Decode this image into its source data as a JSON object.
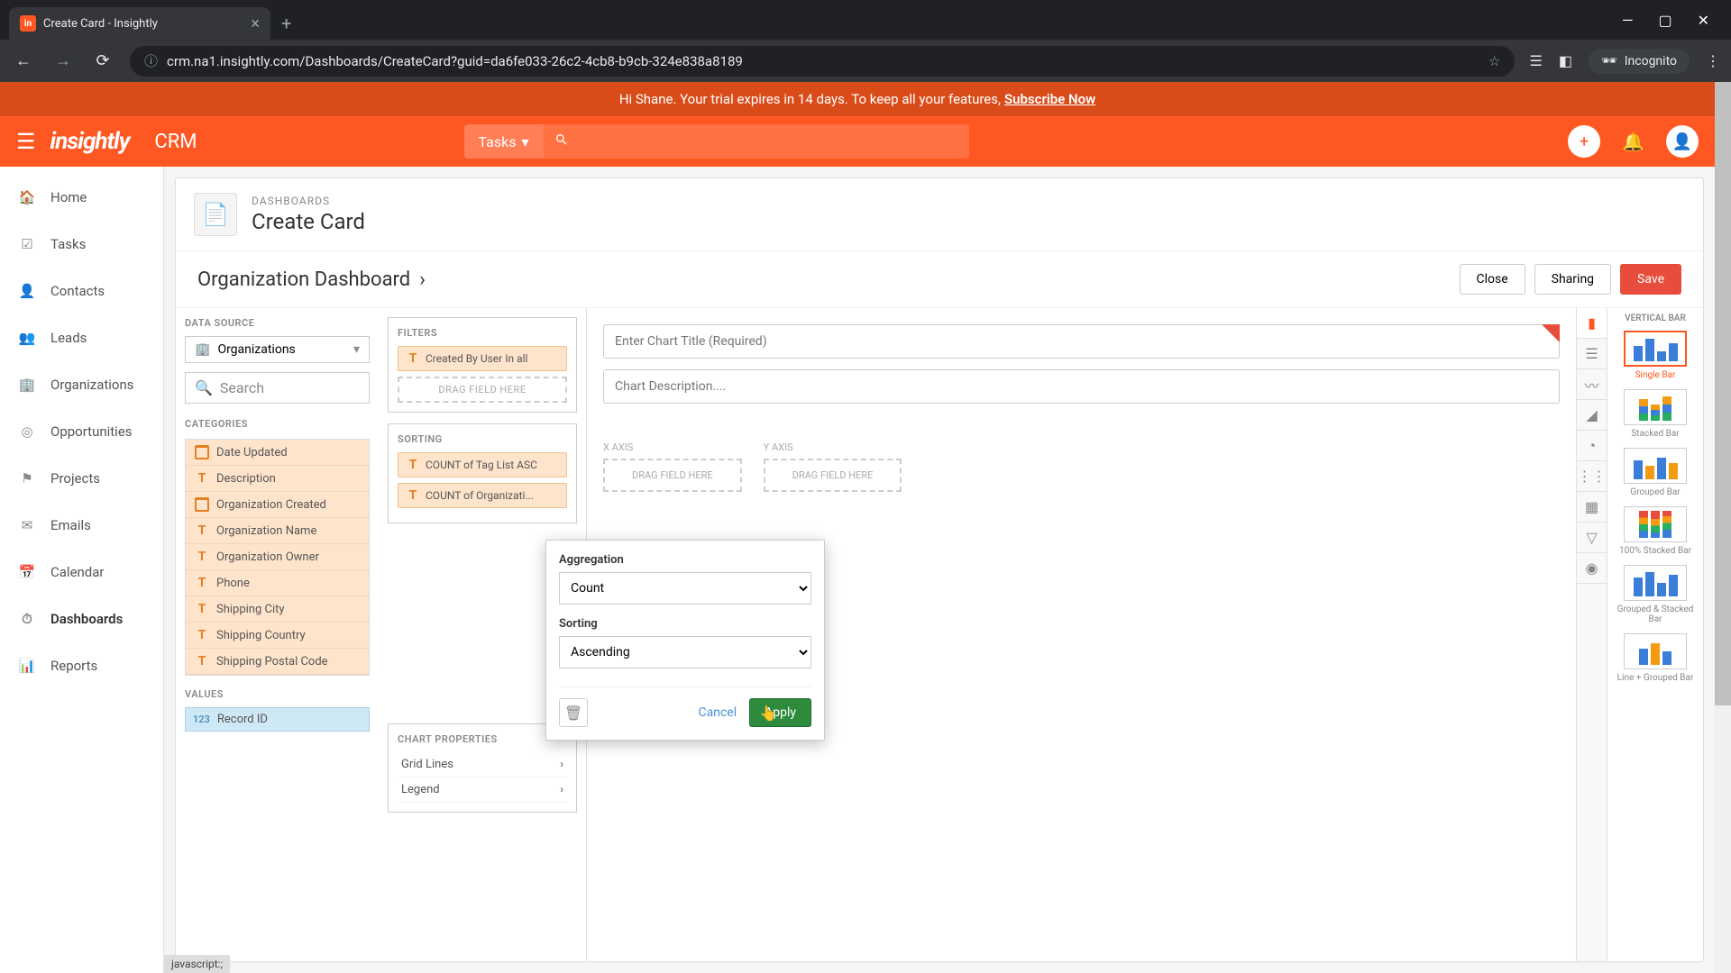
{
  "browser": {
    "tab_title": "Create Card - Insightly",
    "url": "crm.na1.insightly.com/Dashboards/CreateCard?guid=da6fe033-26c2-4cb8-b9cb-324e838a8189",
    "incognito": "Incognito"
  },
  "trial": {
    "greeting": "Hi Shane. Your trial expires in 14 days. To keep all your features,",
    "cta": "Subscribe Now"
  },
  "header": {
    "logo": "insightly",
    "product": "CRM",
    "search_scope": "Tasks"
  },
  "sidebar": {
    "items": [
      {
        "label": "Home",
        "icon": "home"
      },
      {
        "label": "Tasks",
        "icon": "check"
      },
      {
        "label": "Contacts",
        "icon": "person"
      },
      {
        "label": "Leads",
        "icon": "leads"
      },
      {
        "label": "Organizations",
        "icon": "building"
      },
      {
        "label": "Opportunities",
        "icon": "target"
      },
      {
        "label": "Projects",
        "icon": "flag"
      },
      {
        "label": "Emails",
        "icon": "mail"
      },
      {
        "label": "Calendar",
        "icon": "calendar"
      },
      {
        "label": "Dashboards",
        "icon": "gauge"
      },
      {
        "label": "Reports",
        "icon": "bars"
      }
    ]
  },
  "page": {
    "breadcrumb": "DASHBOARDS",
    "title": "Create Card",
    "dashboard_name": "Organization Dashboard",
    "actions": {
      "close": "Close",
      "sharing": "Sharing",
      "save": "Save"
    }
  },
  "builder": {
    "data_source_label": "DATA SOURCE",
    "data_source_value": "Organizations",
    "search_placeholder": "Search",
    "categories_label": "CATEGORIES",
    "categories": [
      {
        "type": "date",
        "label": "Date Updated"
      },
      {
        "type": "T",
        "label": "Description"
      },
      {
        "type": "date",
        "label": "Organization Created"
      },
      {
        "type": "T",
        "label": "Organization Name"
      },
      {
        "type": "T",
        "label": "Organization Owner"
      },
      {
        "type": "T",
        "label": "Phone"
      },
      {
        "type": "T",
        "label": "Shipping City"
      },
      {
        "type": "T",
        "label": "Shipping Country"
      },
      {
        "type": "T",
        "label": "Shipping Postal Code"
      }
    ],
    "values_label": "VALUES",
    "values": [
      {
        "type": "123",
        "label": "Record ID"
      }
    ],
    "filters_label": "FILTERS",
    "filters": [
      {
        "label": "Created By User In all"
      }
    ],
    "drag_hint": "DRAG FIELD HERE",
    "sorting_label": "SORTING",
    "sorting": [
      {
        "label": "COUNT of Tag List ASC"
      },
      {
        "label": "COUNT of Organizati..."
      }
    ],
    "chart_props_label": "CHART PROPERTIES",
    "chart_props": [
      "Grid Lines",
      "Legend"
    ],
    "chart_title_placeholder": "Enter Chart Title (Required)",
    "chart_desc_placeholder": "Chart Description....",
    "x_axis": "X AXIS",
    "y_axis": "Y AXIS"
  },
  "chart_types": {
    "header": "VERTICAL BAR",
    "options": [
      "Single Bar",
      "Stacked Bar",
      "Grouped Bar",
      "100% Stacked Bar",
      "Grouped & Stacked Bar",
      "Line + Grouped Bar"
    ]
  },
  "popover": {
    "aggregation_label": "Aggregation",
    "aggregation_value": "Count",
    "sorting_label": "Sorting",
    "sorting_value": "Ascending",
    "cancel": "Cancel",
    "apply": "Apply"
  },
  "status": "javascript:;"
}
